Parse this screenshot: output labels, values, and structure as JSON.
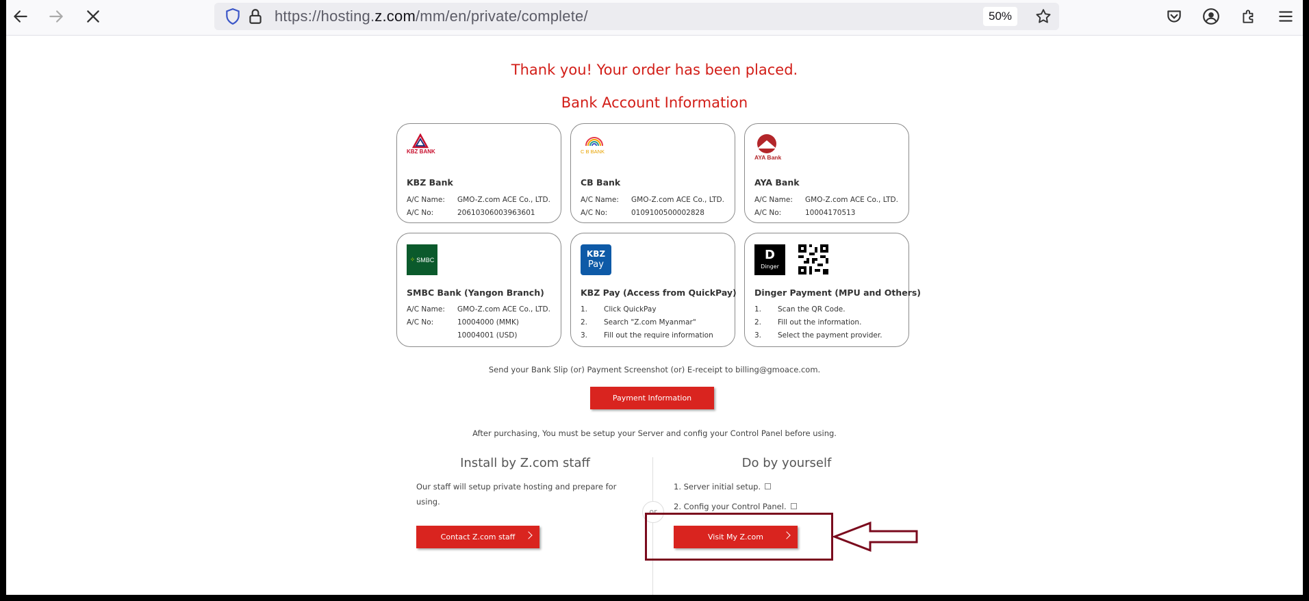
{
  "browser": {
    "url_prefix": "https://hosting.",
    "url_domain": "z.com",
    "url_path": "/mm/en/private/complete/",
    "zoom": "50%"
  },
  "page": {
    "thank_you": "Thank you! Your order has been placed.",
    "bank_heading": "Bank Account Information",
    "banks": [
      {
        "name": "KBZ Bank",
        "logo_text": "KBZ BANK",
        "ac_name_label": "A/C Name:",
        "ac_name": "GMO-Z.com ACE Co., LTD.",
        "ac_no_label": "A/C No:",
        "ac_no": "20610306003963601"
      },
      {
        "name": "CB Bank",
        "logo_text": "C B BANK",
        "ac_name_label": "A/C Name:",
        "ac_name": "GMO-Z.com ACE Co., LTD.",
        "ac_no_label": "A/C No:",
        "ac_no": "0109100500002828"
      },
      {
        "name": "AYA Bank",
        "logo_text": "AYA Bank",
        "ac_name_label": "A/C Name:",
        "ac_name": "GMO-Z.com ACE Co., LTD.",
        "ac_no_label": "A/C No:",
        "ac_no": "10004170513"
      },
      {
        "name": "SMBC Bank (Yangon Branch)",
        "logo_text": "SMBC",
        "ac_name_label": "A/C Name:",
        "ac_name": "GMO-Z.com ACE Co., LTD.",
        "ac_no_label": "A/C No:",
        "ac_no": "10004000 (MMK)",
        "ac_no_2": "10004001 (USD)"
      },
      {
        "name": "KBZ Pay (Access from QuickPay)",
        "logo_text_1": "KBZ",
        "logo_text_2": "Pay",
        "steps": [
          "Click QuickPay",
          "Search \"Z.com Myanmar\"",
          "Fill out the require information"
        ]
      },
      {
        "name": "Dinger Payment (MPU and Others)",
        "logo_text": "Dinger",
        "steps": [
          "Scan the QR Code.",
          "Fill out the information.",
          "Select the payment provider."
        ]
      }
    ],
    "step_nums": [
      "1.",
      "2.",
      "3."
    ],
    "send_slip": "Send your Bank Slip (or) Payment Screenshot (or) E-receipt to billing@gmoace.com.",
    "payment_button": "Payment Information",
    "after_purchasing": "After purchasing, You must be setup your Server and config your Control Panel before using.",
    "install": {
      "title": "Install by Z.com staff",
      "desc": "Our staff will setup private hosting and prepare for using.",
      "button": "Contact Z.com staff"
    },
    "diy": {
      "title": "Do by yourself",
      "items": [
        "1. Server initial setup.",
        "2. Config your Control Panel."
      ],
      "button": "Visit My Z.com"
    },
    "or_label": "or"
  },
  "colors": {
    "accent": "#d9241f",
    "annotation": "#7a0a1d"
  }
}
